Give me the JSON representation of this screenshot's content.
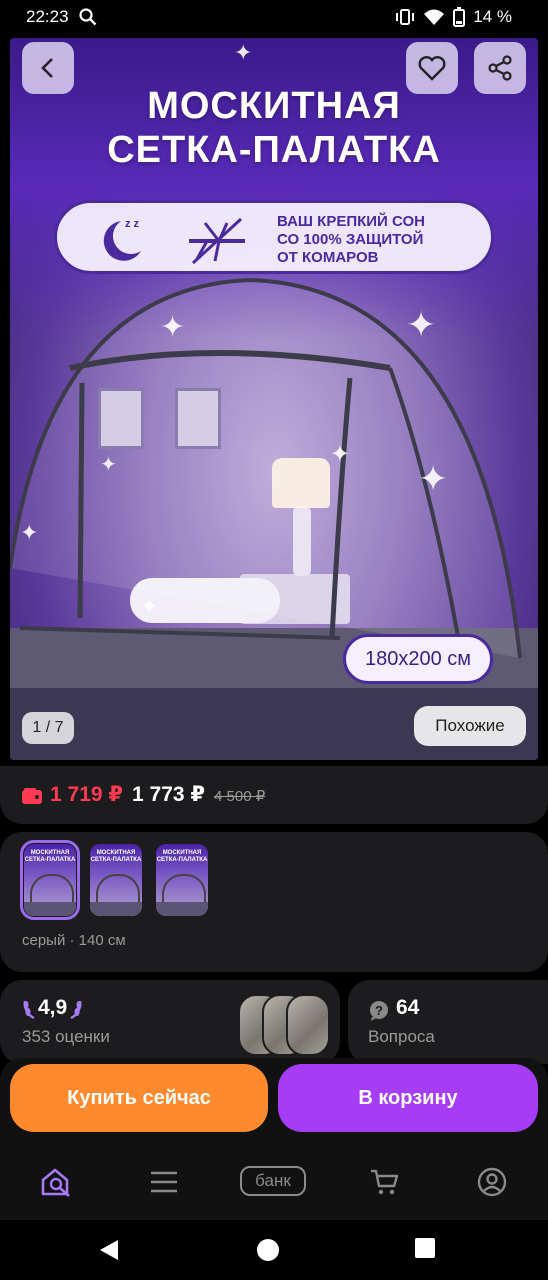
{
  "status_bar": {
    "time": "22:23",
    "battery": "14 %",
    "icons": [
      "search-icon",
      "vibrate-icon",
      "wifi-icon",
      "battery-icon"
    ]
  },
  "product_image": {
    "title_line1": "МОСКИТНАЯ",
    "title_line2": "СЕТКА-ПАЛАТКА",
    "banner_line1": "ВАШ КРЕПКИЙ СОН",
    "banner_line2": "СО 100% ЗАЩИТОЙ",
    "banner_line3": "ОТ КОМАРОВ",
    "size_label": "180х200 см",
    "counter": "1 / 7",
    "similar_button": "Похожие",
    "accent_color": "#4a2a9c"
  },
  "price": {
    "card_price": "1 719 ₽",
    "price": "1 773 ₽",
    "old_price": "4 500 ₽",
    "card_price_color": "#ff3b52"
  },
  "variants": {
    "thumbs": [
      {
        "title": "МОСКИТНАЯ СЕТКА-ПАЛАТКА",
        "selected": true
      },
      {
        "title": "МОСКИТНАЯ СЕТКА-ПАЛАТКА",
        "selected": false
      },
      {
        "title": "МОСКИТНАЯ СЕТКА-ПАЛАТКА",
        "selected": false
      }
    ],
    "selected_label": "серый · 140 см"
  },
  "rating": {
    "value": "4,9",
    "count_label": "353 оценки"
  },
  "questions": {
    "count": "64",
    "label": "Вопроса"
  },
  "actions": {
    "buy_now": "Купить сейчас",
    "add_to_cart": "В корзину",
    "buy_color": "#ff8a2e",
    "cart_color": "#a63cf5"
  },
  "bottom_nav": {
    "bank_label": "банк",
    "items": [
      "home-search-icon",
      "menu-icon",
      "bank",
      "cart-icon",
      "profile-icon"
    ]
  }
}
